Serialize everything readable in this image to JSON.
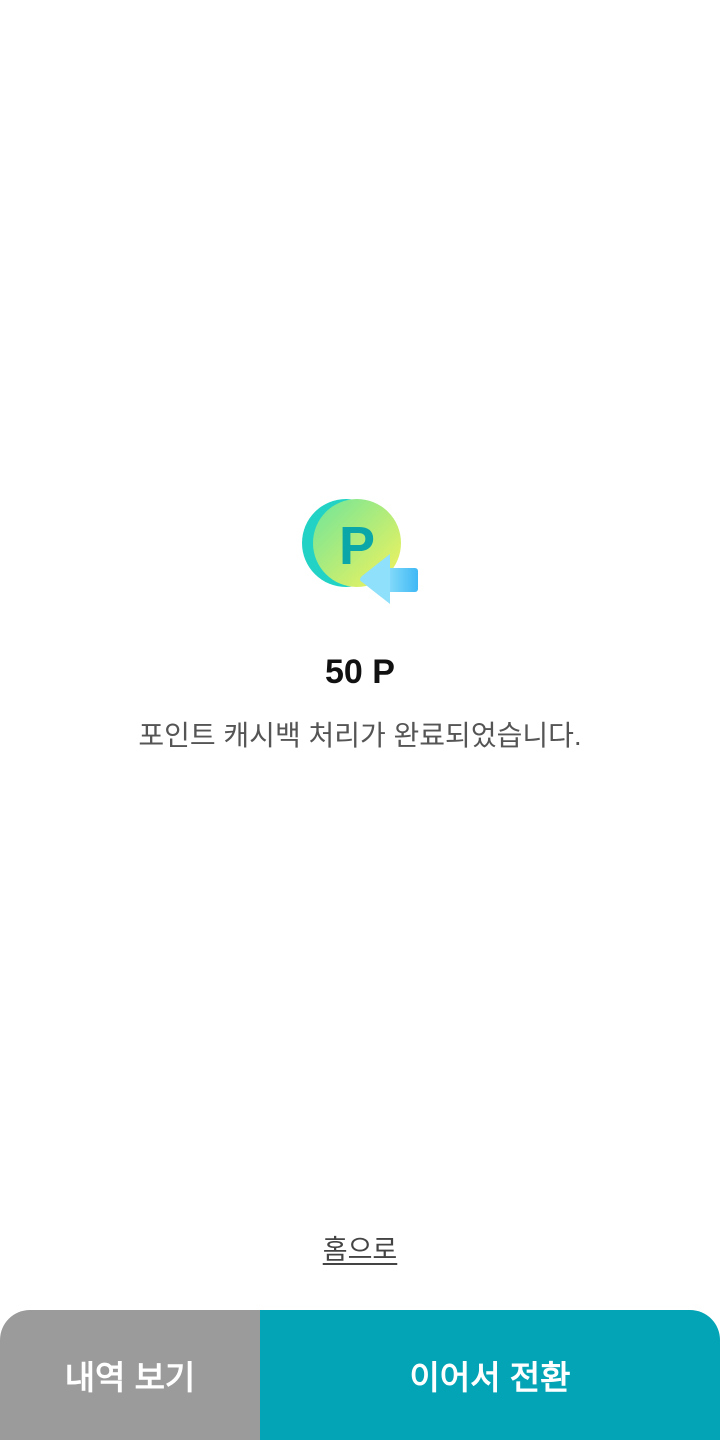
{
  "result": {
    "icon": "point-cashback-icon",
    "amount": "50 P",
    "message": "포인트 캐시백 처리가 완료되었습니다."
  },
  "links": {
    "home_label": "홈으로"
  },
  "buttons": {
    "history_label": "내역 보기",
    "continue_label": "이어서 전환"
  },
  "colors": {
    "accent": "#03a4b6",
    "secondary_button": "#9b9b9b",
    "icon_coin_back": "#22d3c5",
    "icon_coin_front_start": "#7ce88f",
    "icon_coin_front_end": "#f5f05a",
    "icon_letter": "#0aa6a8",
    "icon_arrow": "#5cc9f5"
  }
}
